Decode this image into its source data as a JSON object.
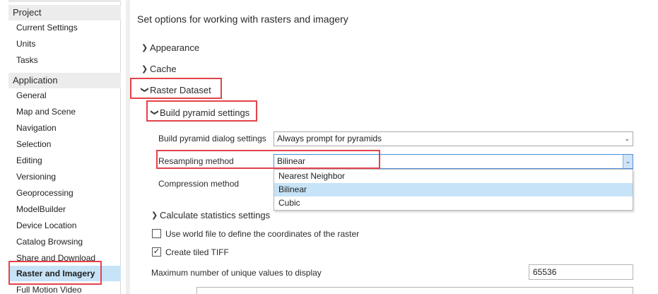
{
  "sidebar": {
    "project_header": "Project",
    "project_items": [
      {
        "label": "Current Settings"
      },
      {
        "label": "Units"
      },
      {
        "label": "Tasks"
      }
    ],
    "application_header": "Application",
    "application_items": [
      {
        "label": "General"
      },
      {
        "label": "Map and Scene"
      },
      {
        "label": "Navigation"
      },
      {
        "label": "Selection"
      },
      {
        "label": "Editing"
      },
      {
        "label": "Versioning"
      },
      {
        "label": "Geoprocessing"
      },
      {
        "label": "ModelBuilder"
      },
      {
        "label": "Device Location"
      },
      {
        "label": "Catalog Browsing"
      },
      {
        "label": "Share and Download"
      },
      {
        "label": "Raster and Imagery",
        "active": true
      },
      {
        "label": "Full Motion Video"
      }
    ]
  },
  "main": {
    "title": "Set options for working with rasters and imagery",
    "sections": {
      "appearance": "Appearance",
      "cache": "Cache",
      "raster_dataset": "Raster Dataset",
      "build_pyramid_settings": "Build pyramid settings",
      "calculate_statistics_settings": "Calculate statistics settings"
    },
    "build_pyramid_dialog": {
      "label": "Build pyramid dialog settings",
      "value": "Always prompt for pyramids"
    },
    "resampling": {
      "label": "Resampling method",
      "value": "Bilinear",
      "options": [
        "Nearest Neighbor",
        "Bilinear",
        "Cubic"
      ]
    },
    "compression": {
      "label": "Compression method"
    },
    "world_file": {
      "label": "Use world file to define the coordinates of the raster",
      "checked": false
    },
    "tiled_tiff": {
      "label": "Create tiled TIFF",
      "checked": true
    },
    "max_unique": {
      "label": "Maximum number of unique values to display",
      "value": "65536"
    }
  },
  "colors": {
    "highlight": "#e3434a",
    "selection": "#c7e3f7",
    "section_header_bg": "#ececec"
  }
}
